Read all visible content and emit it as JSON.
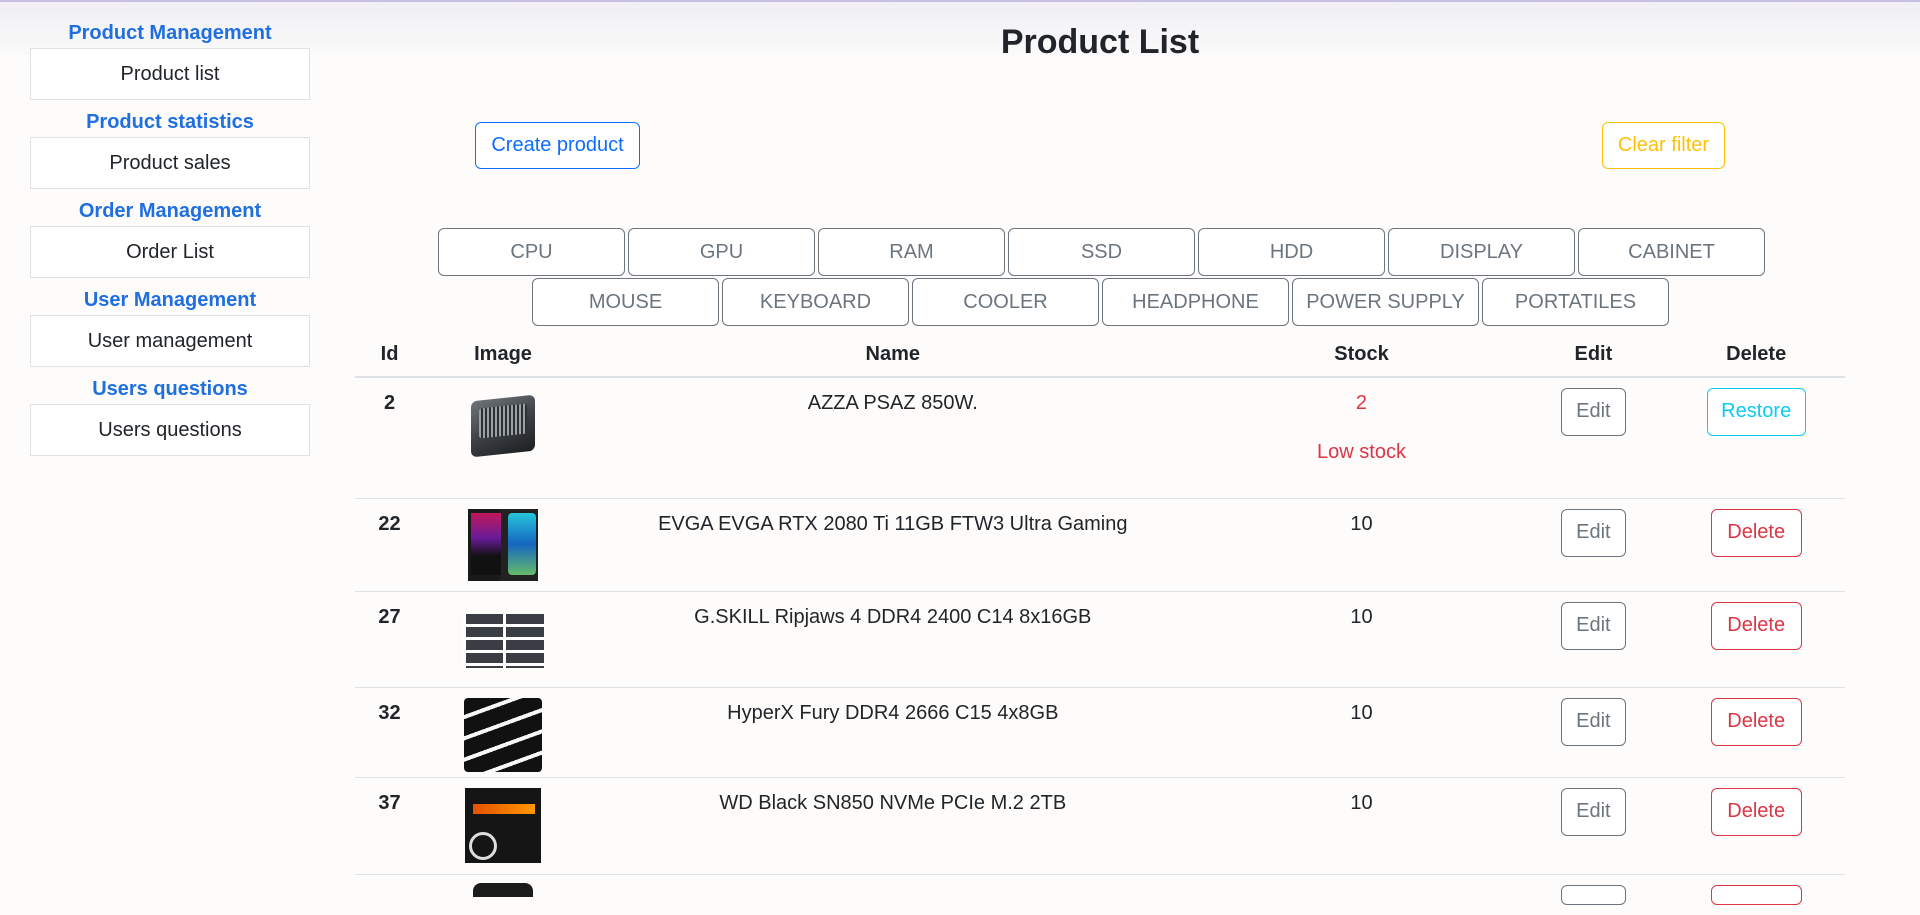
{
  "sidebar": {
    "sections": [
      {
        "heading": "Product Management",
        "item": "Product list"
      },
      {
        "heading": "Product statistics",
        "item": "Product sales"
      },
      {
        "heading": "Order Management",
        "item": "Order List"
      },
      {
        "heading": "User Management",
        "item": "User management"
      },
      {
        "heading": "Users questions",
        "item": "Users questions"
      }
    ]
  },
  "page": {
    "title": "Product List",
    "create_label": "Create product",
    "clear_filter_label": "Clear filter"
  },
  "categories": {
    "row1": [
      "CPU",
      "GPU",
      "RAM",
      "SSD",
      "HDD",
      "DISPLAY",
      "CABINET"
    ],
    "row2": [
      "MOUSE",
      "KEYBOARD",
      "COOLER",
      "HEADPHONE",
      "POWER SUPPLY",
      "PORTATILES"
    ]
  },
  "table": {
    "headers": {
      "id": "Id",
      "image": "Image",
      "name": "Name",
      "stock": "Stock",
      "edit": "Edit",
      "delete": "Delete"
    },
    "rows": [
      {
        "id": "2",
        "name": "AZZA PSAZ 850W.",
        "stock": "2",
        "stock_note": "Low stock",
        "edit": "Edit",
        "action": "Restore",
        "image_icon": "power-supply"
      },
      {
        "id": "22",
        "name": "EVGA EVGA RTX 2080 Ti 11GB FTW3 Ultra Gaming",
        "stock": "10",
        "edit": "Edit",
        "action": "Delete",
        "image_icon": "graphics-card"
      },
      {
        "id": "27",
        "name": "G.SKILL Ripjaws 4 DDR4 2400 C14 8x16GB",
        "stock": "10",
        "edit": "Edit",
        "action": "Delete",
        "image_icon": "ram-kit"
      },
      {
        "id": "32",
        "name": "HyperX Fury DDR4 2666 C15 4x8GB",
        "stock": "10",
        "edit": "Edit",
        "action": "Delete",
        "image_icon": "ram-kit"
      },
      {
        "id": "37",
        "name": "WD Black SN850 NVMe PCIe M.2 2TB",
        "stock": "10",
        "edit": "Edit",
        "action": "Delete",
        "image_icon": "ssd"
      }
    ]
  },
  "colors": {
    "primary": "#0d6efd",
    "warning": "#ffc107",
    "danger": "#dc3545",
    "info": "#0dcaf0",
    "secondary": "#6c757d",
    "sidebar_heading": "#1f6fe0"
  }
}
